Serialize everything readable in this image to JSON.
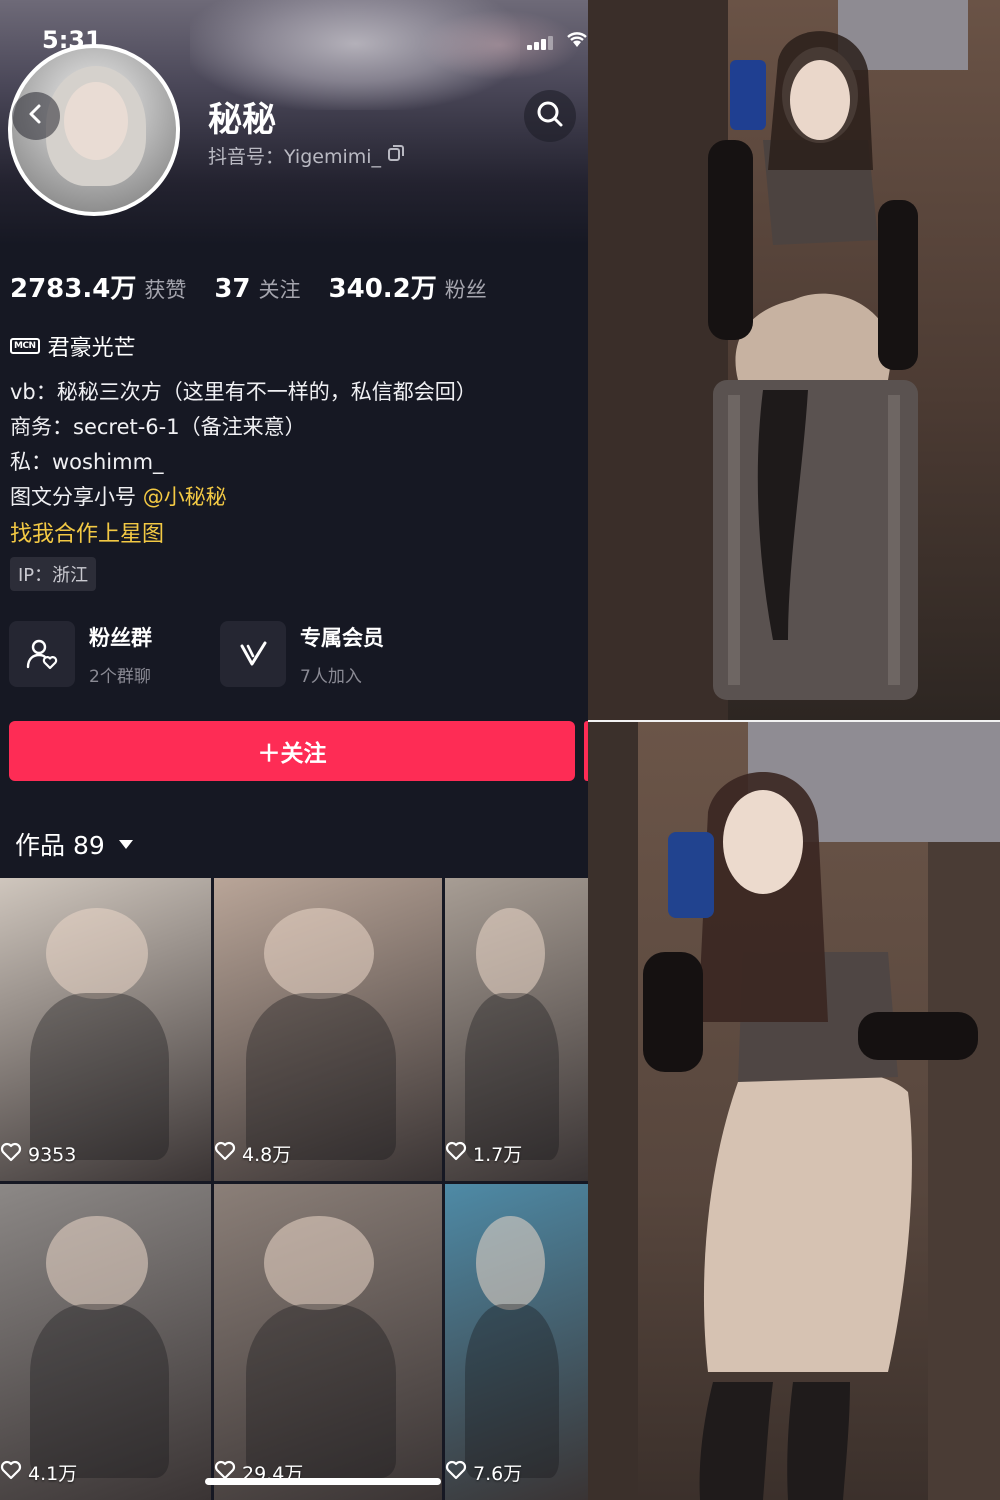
{
  "status_bar": {
    "time": "5:31"
  },
  "profile": {
    "nickname": "秘秘",
    "douyin_id": "抖音号：Yigemimi_",
    "stats": [
      {
        "num": "2783.4万",
        "label": "获赞"
      },
      {
        "num": "37",
        "label": "关注"
      },
      {
        "num": "340.2万",
        "label": "粉丝"
      }
    ],
    "mcn_badge": "MCN",
    "mcn_name": "君豪光芒",
    "bio_lines": [
      "vb：秘秘三次方（这里有不一样的，私信都会回）",
      "商务：secret-6-1（备注来意）",
      "私：woshimm_"
    ],
    "bio_share_prefix": "图文分享小号",
    "bio_share_link": "@小秘秘",
    "cooperation": "找我合作上星图",
    "ip": "IP：浙江"
  },
  "cards": [
    {
      "title": "粉丝群",
      "sub": "2个群聊",
      "icon": "fan-group-icon"
    },
    {
      "title": "专属会员",
      "sub": "7人加入",
      "icon": "membership-v-icon"
    }
  ],
  "follow_button": "＋关注",
  "works": {
    "label": "作品 89",
    "items": [
      {
        "likes": "9353",
        "color": "#cfc6bd"
      },
      {
        "likes": "4.8万",
        "color": "#b9a598"
      },
      {
        "likes": "1.7万",
        "color": "#a79d94"
      },
      {
        "likes": "4.1万",
        "color": "#8c8886"
      },
      {
        "likes": "29.4万",
        "color": "#8b7f78"
      },
      {
        "likes": "7.6万",
        "color": "#4e8aa6"
      }
    ]
  },
  "colors": {
    "background": "#161823",
    "follow": "#fe2c55",
    "link": "#f3c944"
  }
}
